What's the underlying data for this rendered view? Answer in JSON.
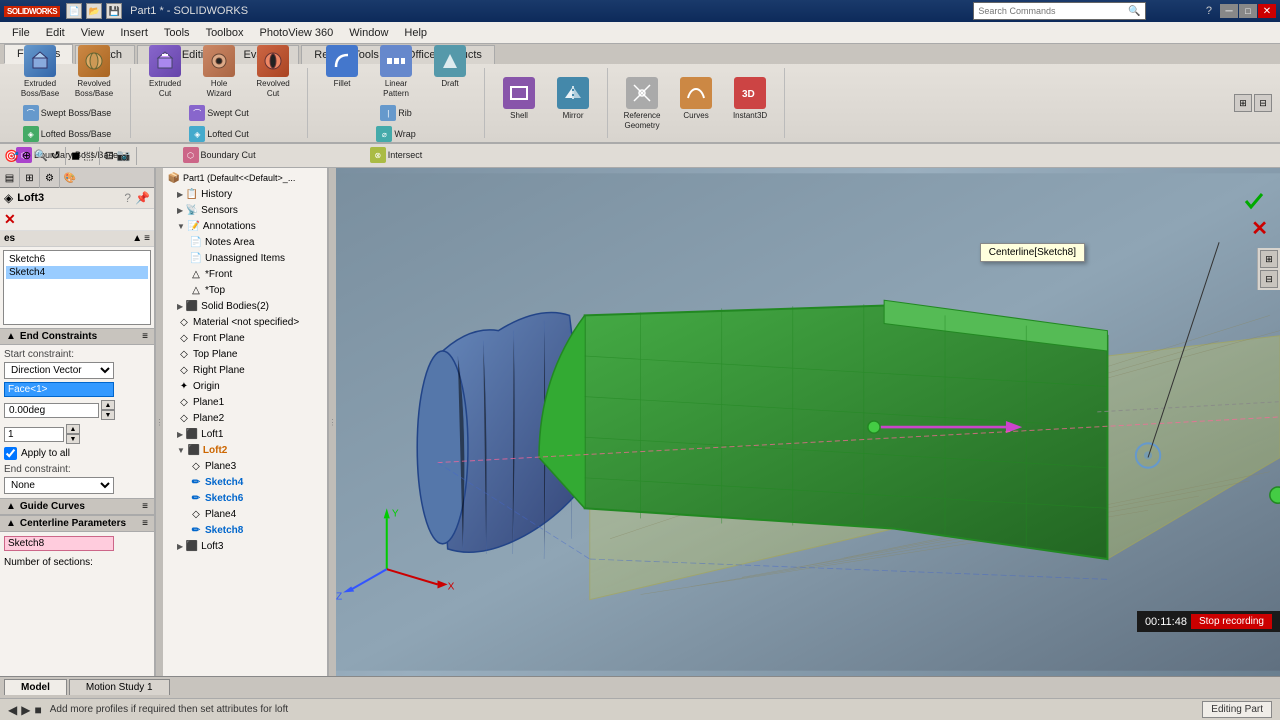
{
  "app": {
    "name": "SOLIDWORKS",
    "title": "Part1 *",
    "logo": "SOLIDWORKS"
  },
  "titlebar": {
    "title": "Part1 * - SOLIDWORKS",
    "search_placeholder": "Search Commands"
  },
  "menu": {
    "items": [
      "File",
      "Edit",
      "View",
      "Insert",
      "Tools",
      "Toolbox",
      "PhotoView 360",
      "Window",
      "Help"
    ]
  },
  "ribbon": {
    "tabs": [
      "Features",
      "Sketch",
      "Direct Editing",
      "Evaluate",
      "Render Tools",
      "Office Products"
    ],
    "active_tab": "Features",
    "groups": {
      "boss_base": {
        "items": [
          "Extruded Boss/Base",
          "Revolved Boss/Base",
          "Swept Boss/Base",
          "Lofted Boss/Base",
          "Boundary Boss/Base"
        ]
      },
      "cut": {
        "items": [
          "Extruded Cut",
          "Revolved Cut",
          "Swept Cut",
          "Lofted Cut",
          "Boundary Cut"
        ]
      },
      "features": {
        "items": [
          "Fillet",
          "Linear Pattern",
          "Draft",
          "Rib",
          "Wrap",
          "Intersect",
          "Shell",
          "Mirror"
        ]
      },
      "geometry": {
        "items": [
          "Reference Geometry",
          "Curves",
          "Instant3D"
        ]
      }
    }
  },
  "left_panel": {
    "title": "Loft3",
    "close_label": "✕",
    "ok_icon": "✓",
    "cancel_icon": "✕",
    "profiles_label": "Profiles",
    "profiles_items": [
      "Sketch6",
      "Sketch4"
    ],
    "end_constraints": {
      "header": "End Constraints",
      "start_label": "Start constraint:",
      "start_value": "Direction Vector",
      "face_value": "Face<1>",
      "angle_value": "0.00deg",
      "multiplier_value": "1",
      "apply_to_all": "Apply to all",
      "end_label": "End constraint:",
      "end_value": "None"
    },
    "guide_curves": {
      "header": "Guide Curves"
    },
    "centerline": {
      "header": "Centerline Parameters",
      "value": "Sketch8"
    },
    "sections_label": "Number of sections:"
  },
  "feature_tree": {
    "part_name": "Part1 (Default<<Default>_...",
    "items": [
      {
        "label": "History",
        "indent": 1,
        "icon": "📋",
        "expanded": false
      },
      {
        "label": "Sensors",
        "indent": 1,
        "icon": "📡",
        "expanded": false
      },
      {
        "label": "Annotations",
        "indent": 1,
        "icon": "📝",
        "expanded": true
      },
      {
        "label": "Notes Area",
        "indent": 2,
        "icon": "📄"
      },
      {
        "label": "Unassigned Items",
        "indent": 2,
        "icon": "📄"
      },
      {
        "label": "*Front",
        "indent": 2,
        "icon": "△"
      },
      {
        "label": "*Top",
        "indent": 2,
        "icon": "△"
      },
      {
        "label": "Solid Bodies(2)",
        "indent": 1,
        "icon": "⬛",
        "expanded": false
      },
      {
        "label": "Material <not specified>",
        "indent": 1,
        "icon": "◇"
      },
      {
        "label": "Front Plane",
        "indent": 1,
        "icon": "◇"
      },
      {
        "label": "Top Plane",
        "indent": 1,
        "icon": "◇"
      },
      {
        "label": "Right Plane",
        "indent": 1,
        "icon": "◇"
      },
      {
        "label": "Origin",
        "indent": 1,
        "icon": "✦"
      },
      {
        "label": "Plane1",
        "indent": 1,
        "icon": "◇"
      },
      {
        "label": "Plane2",
        "indent": 1,
        "icon": "◇"
      },
      {
        "label": "Loft1",
        "indent": 1,
        "icon": "⬛",
        "expanded": false
      },
      {
        "label": "Loft2",
        "indent": 1,
        "icon": "⬛",
        "color": "orange",
        "expanded": true
      },
      {
        "label": "Plane3",
        "indent": 2,
        "icon": "◇"
      },
      {
        "label": "Sketch4",
        "indent": 2,
        "icon": "✏",
        "color": "blue"
      },
      {
        "label": "Sketch6",
        "indent": 2,
        "icon": "✏",
        "color": "blue"
      },
      {
        "label": "Plane4",
        "indent": 2,
        "icon": "◇"
      },
      {
        "label": "Sketch8",
        "indent": 2,
        "icon": "✏",
        "color": "blue"
      },
      {
        "label": "Loft3",
        "indent": 1,
        "icon": "⬛",
        "expanded": false
      }
    ]
  },
  "viewport": {
    "centerline_tooltip": "Centerline[Sketch8]",
    "coord_system": {
      "x_label": "X",
      "y_label": "Y",
      "z_label": "Z"
    }
  },
  "statusbar": {
    "message": "Add more profiles if required then set attributes for loft",
    "editing": "Editing Part"
  },
  "bottom_tabs": {
    "tabs": [
      "Model",
      "Motion Study 1"
    ],
    "active": "Model"
  },
  "timer": {
    "time": "00:11:48",
    "stop_label": "Stop recording"
  },
  "accept": "✓",
  "cancel_x": "✕"
}
